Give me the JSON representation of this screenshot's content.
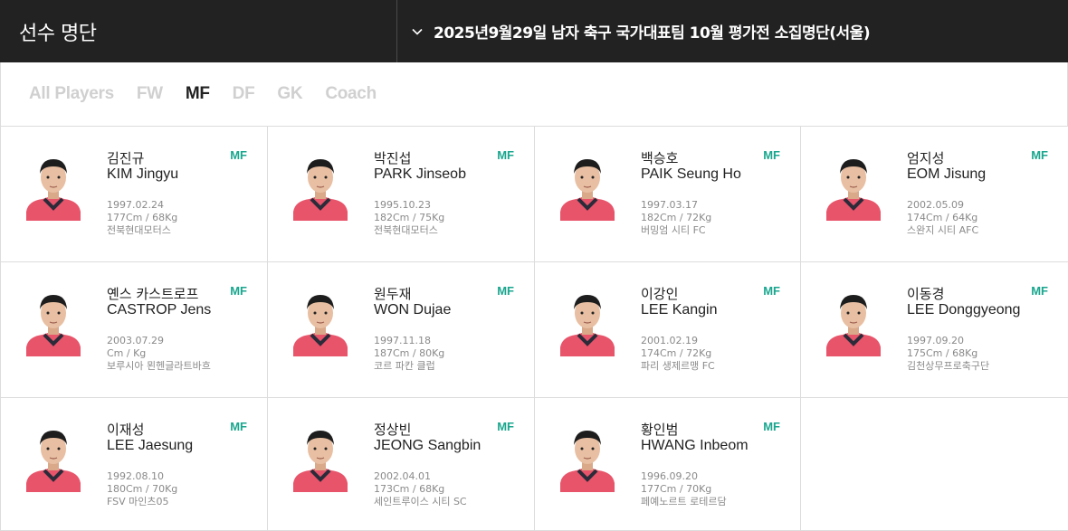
{
  "header": {
    "title": "선수 명단",
    "selected_roster": "2025년9월29일 남자 축구 국가대표팀 10월 평가전 소집명단(서울)"
  },
  "tabs": [
    {
      "label": "All Players",
      "active": false
    },
    {
      "label": "FW",
      "active": false
    },
    {
      "label": "MF",
      "active": true
    },
    {
      "label": "DF",
      "active": false
    },
    {
      "label": "GK",
      "active": false
    },
    {
      "label": "Coach",
      "active": false
    }
  ],
  "colors": {
    "accent": "#1aa68e",
    "topbar": "#222222",
    "tab_inactive": "#d0d0d0",
    "jersey": "#e8546a"
  },
  "players": [
    {
      "name_kr": "김진규",
      "name_en": "KIM Jingyu",
      "pos": "MF",
      "birth": "1997.02.24",
      "body": "177Cm / 68Kg",
      "club": "전북현대모터스"
    },
    {
      "name_kr": "박진섭",
      "name_en": "PARK Jinseob",
      "pos": "MF",
      "birth": "1995.10.23",
      "body": "182Cm / 75Kg",
      "club": "전북현대모터스"
    },
    {
      "name_kr": "백승호",
      "name_en": "PAIK Seung Ho",
      "pos": "MF",
      "birth": "1997.03.17",
      "body": "182Cm / 72Kg",
      "club": "버밍엄 시티 FC"
    },
    {
      "name_kr": "엄지성",
      "name_en": "EOM Jisung",
      "pos": "MF",
      "birth": "2002.05.09",
      "body": "174Cm / 64Kg",
      "club": "스완지 시티 AFC"
    },
    {
      "name_kr": "옌스 카스트로프",
      "name_en": "CASTROP Jens",
      "pos": "MF",
      "birth": "2003.07.29",
      "body": "Cm / Kg",
      "club": "보루시아 묀헨글라트바흐"
    },
    {
      "name_kr": "원두재",
      "name_en": "WON Dujae",
      "pos": "MF",
      "birth": "1997.11.18",
      "body": "187Cm / 80Kg",
      "club": "코르 파칸 클럽"
    },
    {
      "name_kr": "이강인",
      "name_en": "LEE Kangin",
      "pos": "MF",
      "birth": "2001.02.19",
      "body": "174Cm / 72Kg",
      "club": "파리 생제르맹 FC"
    },
    {
      "name_kr": "이동경",
      "name_en": "LEE Donggyeong",
      "pos": "MF",
      "birth": "1997.09.20",
      "body": "175Cm / 68Kg",
      "club": "김천상무프로축구단"
    },
    {
      "name_kr": "이재성",
      "name_en": "LEE Jaesung",
      "pos": "MF",
      "birth": "1992.08.10",
      "body": "180Cm / 70Kg",
      "club": "FSV 마인츠05"
    },
    {
      "name_kr": "정상빈",
      "name_en": "JEONG Sangbin",
      "pos": "MF",
      "birth": "2002.04.01",
      "body": "173Cm / 68Kg",
      "club": "세인트루이스 시티 SC"
    },
    {
      "name_kr": "황인범",
      "name_en": "HWANG Inbeom",
      "pos": "MF",
      "birth": "1996.09.20",
      "body": "177Cm / 70Kg",
      "club": "페예노르트 로테르담"
    }
  ]
}
